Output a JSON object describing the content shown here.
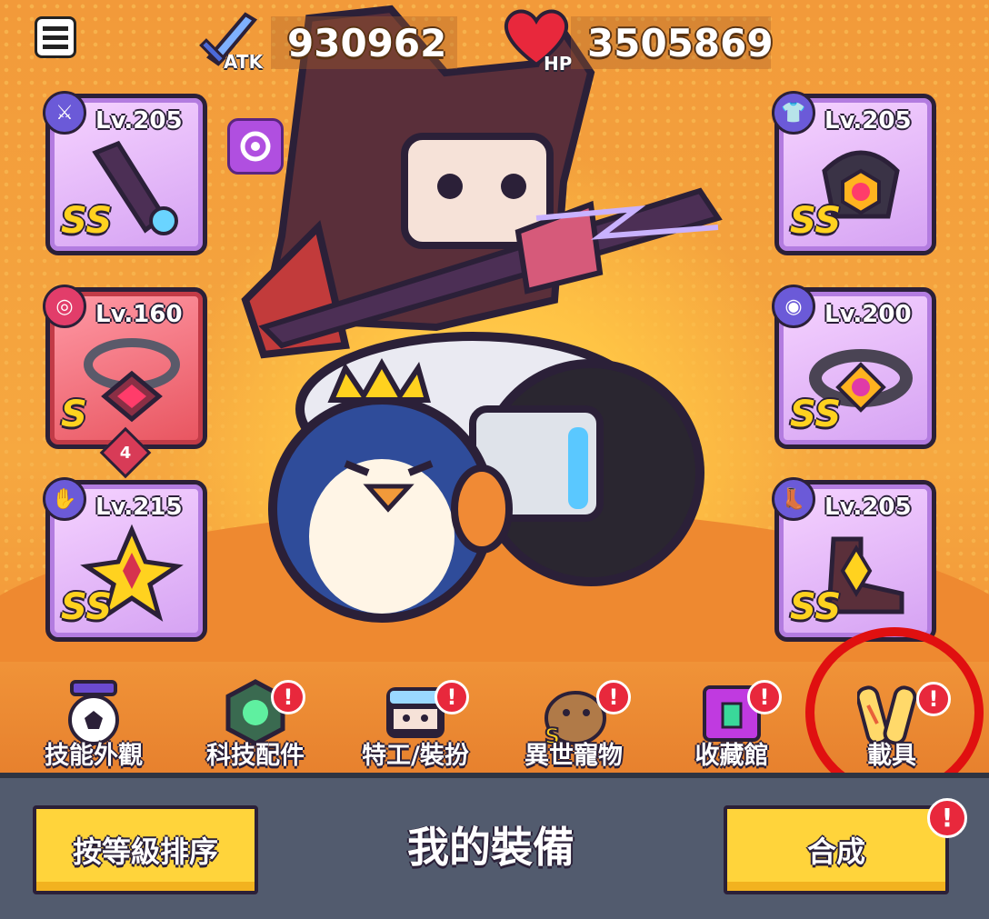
{
  "stats": {
    "atk_label": "ATK",
    "atk_value": "930962",
    "hp_label": "HP",
    "hp_value": "3505869"
  },
  "equipment": {
    "left": [
      {
        "type_icon": "weapon-icon",
        "level": "Lv.205",
        "grade": "SS"
      },
      {
        "type_icon": "necklace-icon",
        "level": "Lv.160",
        "grade": "S",
        "stars": "4"
      },
      {
        "type_icon": "glove-icon",
        "level": "Lv.215",
        "grade": "SS"
      }
    ],
    "right": [
      {
        "type_icon": "armor-icon",
        "level": "Lv.205",
        "grade": "SS"
      },
      {
        "type_icon": "belt-icon",
        "level": "Lv.200",
        "grade": "SS"
      },
      {
        "type_icon": "boots-icon",
        "level": "Lv.205",
        "grade": "SS"
      }
    ]
  },
  "tabs": [
    {
      "label": "技能外觀",
      "alert": false
    },
    {
      "label": "科技配件",
      "alert": true
    },
    {
      "label": "特工/裝扮",
      "alert": true
    },
    {
      "label": "異世寵物",
      "alert": true
    },
    {
      "label": "收藏館",
      "alert": true
    },
    {
      "label": "載具",
      "alert": true
    }
  ],
  "alert_mark": "!",
  "bottom": {
    "sort_label": "按等級排序",
    "title": "我的裝備",
    "synth_label": "合成"
  },
  "colors": {
    "highlight_ring": "#e01010",
    "slot_purple": "#d5a2f3",
    "slot_red": "#e8545f",
    "button_yellow": "#ffd43b",
    "bottom_bar": "#525b6e"
  }
}
